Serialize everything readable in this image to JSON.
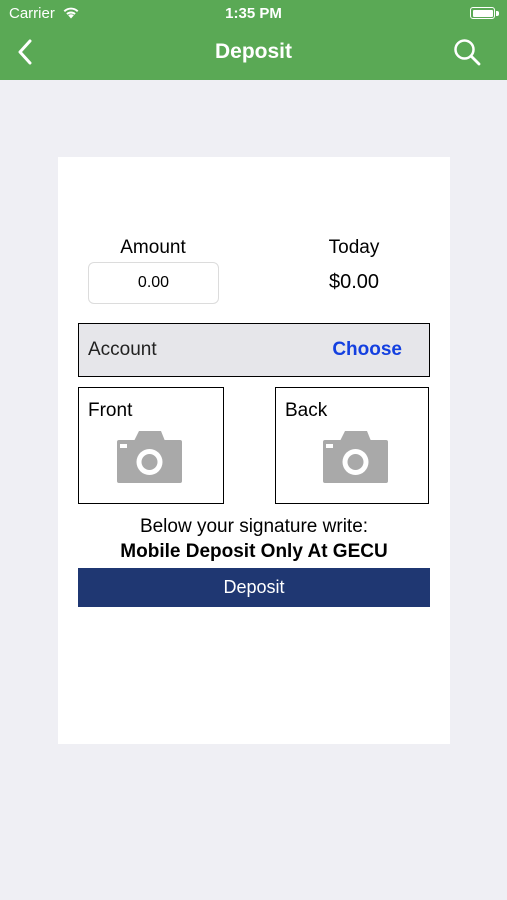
{
  "status_bar": {
    "carrier": "Carrier",
    "time": "1:35 PM"
  },
  "nav": {
    "title": "Deposit",
    "back_icon": "chevron-left-icon",
    "search_icon": "search-icon"
  },
  "form": {
    "amount_label": "Amount",
    "amount_value": "0.00",
    "today_label": "Today",
    "today_value": "$0.00",
    "account_label": "Account",
    "account_action": "Choose",
    "front_label": "Front",
    "back_label": "Back",
    "camera_icon": "camera-icon",
    "instruction": "Below your signature write:",
    "instruction_bold": "Mobile Deposit Only At GECU",
    "deposit_button": "Deposit"
  },
  "colors": {
    "nav_bar": "#5aa955",
    "background": "#efeff4",
    "choose_link": "#1440e0",
    "deposit_button": "#1f3772",
    "account_row": "#e6e6ea",
    "camera_icon": "#a9a9a9"
  }
}
